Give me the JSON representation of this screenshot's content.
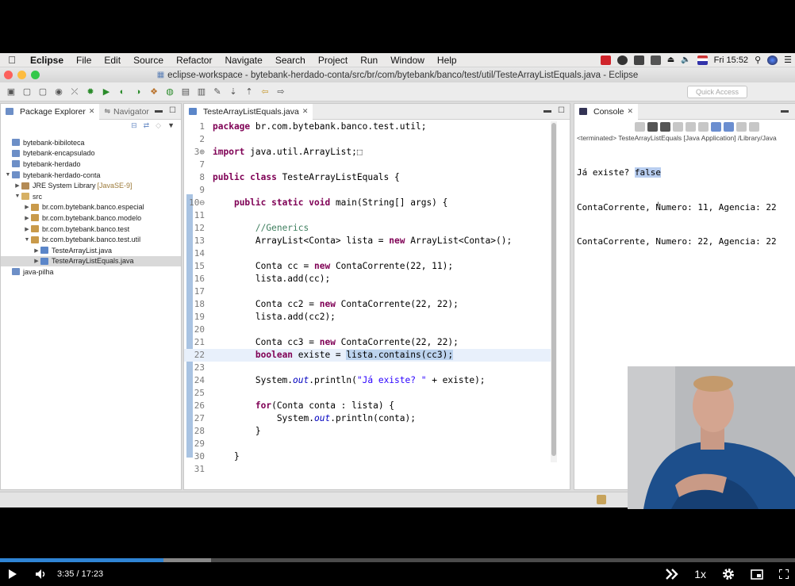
{
  "menubar": {
    "app_name": "Eclipse",
    "items": [
      "File",
      "Edit",
      "Source",
      "Refactor",
      "Navigate",
      "Search",
      "Project",
      "Run",
      "Window",
      "Help"
    ],
    "clock": "Fri 15:52"
  },
  "window": {
    "title": "eclipse-workspace - bytebank-herdado-conta/src/br/com/bytebank/banco/test/util/TesteArrayListEquals.java - Eclipse"
  },
  "toolbar": {
    "quick_access_placeholder": "Quick Access"
  },
  "explorer": {
    "tab_label": "Package Explorer",
    "navigator_label": "Navigator",
    "tree": [
      {
        "label": "bytebank-bibiloteca",
        "icon": "project-icon",
        "indent": 0,
        "arrow": ""
      },
      {
        "label": "bytebank-encapsulado",
        "icon": "project-icon",
        "indent": 0,
        "arrow": ""
      },
      {
        "label": "bytebank-herdado",
        "icon": "project-icon",
        "indent": 0,
        "arrow": ""
      },
      {
        "label": "bytebank-herdado-conta",
        "icon": "project-icon",
        "indent": 0,
        "arrow": "▼"
      },
      {
        "label": "JRE System Library",
        "suffix": "[JavaSE-9]",
        "icon": "library-icon",
        "indent": 1,
        "arrow": "▶"
      },
      {
        "label": "src",
        "icon": "source-folder-icon",
        "indent": 1,
        "arrow": "▼"
      },
      {
        "label": "br.com.bytebank.banco.especial",
        "icon": "package-icon",
        "indent": 2,
        "arrow": "▶"
      },
      {
        "label": "br.com.bytebank.banco.modelo",
        "icon": "package-icon",
        "indent": 2,
        "arrow": "▶"
      },
      {
        "label": "br.com.bytebank.banco.test",
        "icon": "package-icon",
        "indent": 2,
        "arrow": "▶"
      },
      {
        "label": "br.com.bytebank.banco.test.util",
        "icon": "package-icon",
        "indent": 2,
        "arrow": "▼"
      },
      {
        "label": "TesteArrayList.java",
        "icon": "java-file-icon",
        "indent": 3,
        "arrow": "▶"
      },
      {
        "label": "TesteArrayListEquals.java",
        "icon": "java-file-icon",
        "indent": 3,
        "arrow": "▶",
        "selected": true
      },
      {
        "label": "java-pilha",
        "icon": "project-icon",
        "indent": 0,
        "arrow": ""
      }
    ]
  },
  "editor": {
    "tab_label": "TesteArrayListEquals.java",
    "lines": [
      {
        "n": "1",
        "html": "<span class=\"kw\">package</span> br.com.bytebank.banco.test.util;"
      },
      {
        "n": "2",
        "html": ""
      },
      {
        "n": "3⊕",
        "html": "<span class=\"kw\">import</span> java.util.ArrayList;⬚"
      },
      {
        "n": "7",
        "html": ""
      },
      {
        "n": "8",
        "html": "<span class=\"kw\">public class</span> TesteArrayListEquals {"
      },
      {
        "n": "9",
        "html": ""
      },
      {
        "n": "10⊖",
        "html": "    <span class=\"kw\">public static void</span> main(String[] args) {"
      },
      {
        "n": "11",
        "html": ""
      },
      {
        "n": "12",
        "html": "        <span class=\"com\">//Generics</span>"
      },
      {
        "n": "13",
        "html": "        ArrayList&lt;Conta&gt; lista = <span class=\"kw\">new</span> ArrayList&lt;Conta&gt;();"
      },
      {
        "n": "14",
        "html": ""
      },
      {
        "n": "15",
        "html": "        Conta cc = <span class=\"kw\">new</span> ContaCorrente(22, 11);"
      },
      {
        "n": "16",
        "html": "        lista.add(cc);"
      },
      {
        "n": "17",
        "html": ""
      },
      {
        "n": "18",
        "html": "        Conta cc2 = <span class=\"kw\">new</span> ContaCorrente(22, 22);"
      },
      {
        "n": "19",
        "html": "        lista.add(cc2);"
      },
      {
        "n": "20",
        "html": ""
      },
      {
        "n": "21",
        "html": "        Conta cc3 = <span class=\"kw\">new</span> ContaCorrente(22, 22);"
      },
      {
        "n": "22",
        "html": "        <span class=\"kw\">boolean</span> existe = <span class=\"hl\">lista.contains(cc3);</span>",
        "current": true
      },
      {
        "n": "23",
        "html": ""
      },
      {
        "n": "24",
        "html": "        System.<span class=\"fld\">out</span>.println(<span class=\"str\">\"Já existe? \"</span> + existe);"
      },
      {
        "n": "25",
        "html": ""
      },
      {
        "n": "26",
        "html": "        <span class=\"kw\">for</span>(Conta conta : lista) {"
      },
      {
        "n": "27",
        "html": "            System.<span class=\"fld\">out</span>.println(conta);"
      },
      {
        "n": "28",
        "html": "        }"
      },
      {
        "n": "29",
        "html": ""
      },
      {
        "n": "30",
        "html": "    }"
      },
      {
        "n": "31",
        "html": ""
      }
    ]
  },
  "console": {
    "tab_label": "Console",
    "status": "<terminated> TesteArrayListEquals [Java Application] /Library/Java",
    "output_prefix": "Já existe? ",
    "output_value": "false",
    "output_lines": [
      "ContaCorrente, Numero: 11, Agencia: 22",
      "ContaCorrente, Numero: 22, Agencia: 22"
    ]
  },
  "player": {
    "current_time": "3:35",
    "separator": "/",
    "duration": "17:23",
    "played_fraction": 0.206,
    "speed": "1x"
  }
}
